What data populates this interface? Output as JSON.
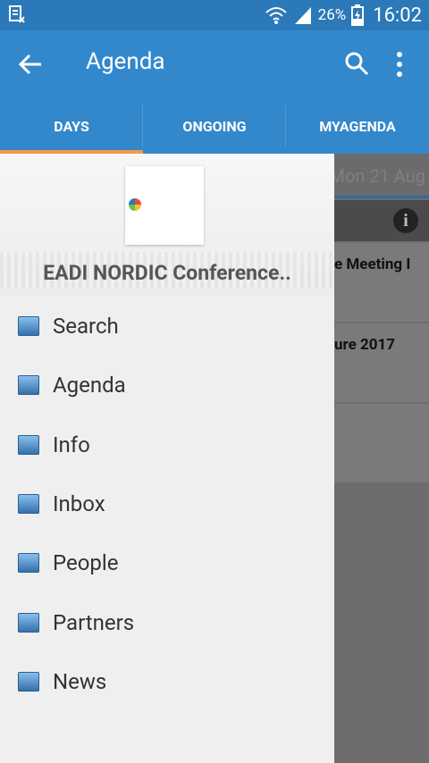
{
  "statusbar": {
    "battery": "26%",
    "time": "16:02"
  },
  "appbar": {
    "title": "Agenda"
  },
  "tabs": [
    "DAYS",
    "ONGOING",
    "MYAGENDA"
  ],
  "day_header": "Mon 21 Aug",
  "cards": [
    "e Meeting I",
    "ure 2017"
  ],
  "conference": {
    "name": "EADI NORDIC Conference.."
  },
  "menu": [
    {
      "label": "Search",
      "icon": "search-icon"
    },
    {
      "label": "Agenda",
      "icon": "agenda-icon"
    },
    {
      "label": "Info",
      "icon": "info-icon"
    },
    {
      "label": "Inbox",
      "icon": "inbox-icon"
    },
    {
      "label": "People",
      "icon": "people-icon"
    },
    {
      "label": "Partners",
      "icon": "partners-icon"
    },
    {
      "label": "News",
      "icon": "news-icon"
    }
  ],
  "colors": {
    "appbar": "#3388cc",
    "status": "#2b79b8",
    "tab_indicator": "#f29a46"
  }
}
